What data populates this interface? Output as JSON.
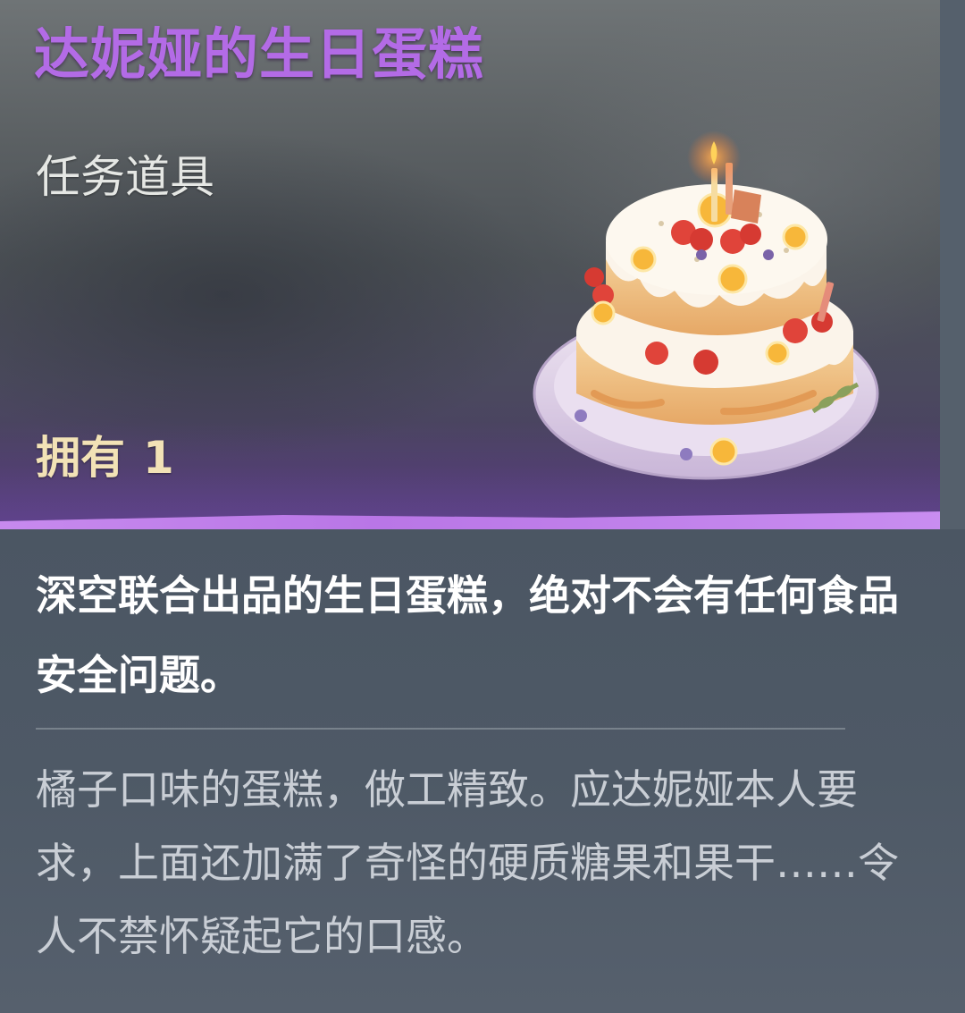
{
  "item": {
    "name": "达妮娅的生日蛋糕",
    "type": "任务道具",
    "owned_label": "拥有",
    "owned_count": "1",
    "icon": "birthday-cake-icon"
  },
  "text": {
    "description": "深空联合出品的生日蛋糕，绝对不会有任何食品安全问题。",
    "flavor": "橘子口味的蛋糕，做工精致。应达妮娅本人要求，上面还加满了奇怪的硬质糖果和果干……令人不禁怀疑起它的口感。"
  },
  "colors": {
    "title": "#b36be6",
    "owned": "#f2e2b6",
    "accent_stripe": "#c78aee",
    "description": "#ffffff",
    "flavor": "#c9ced5"
  }
}
